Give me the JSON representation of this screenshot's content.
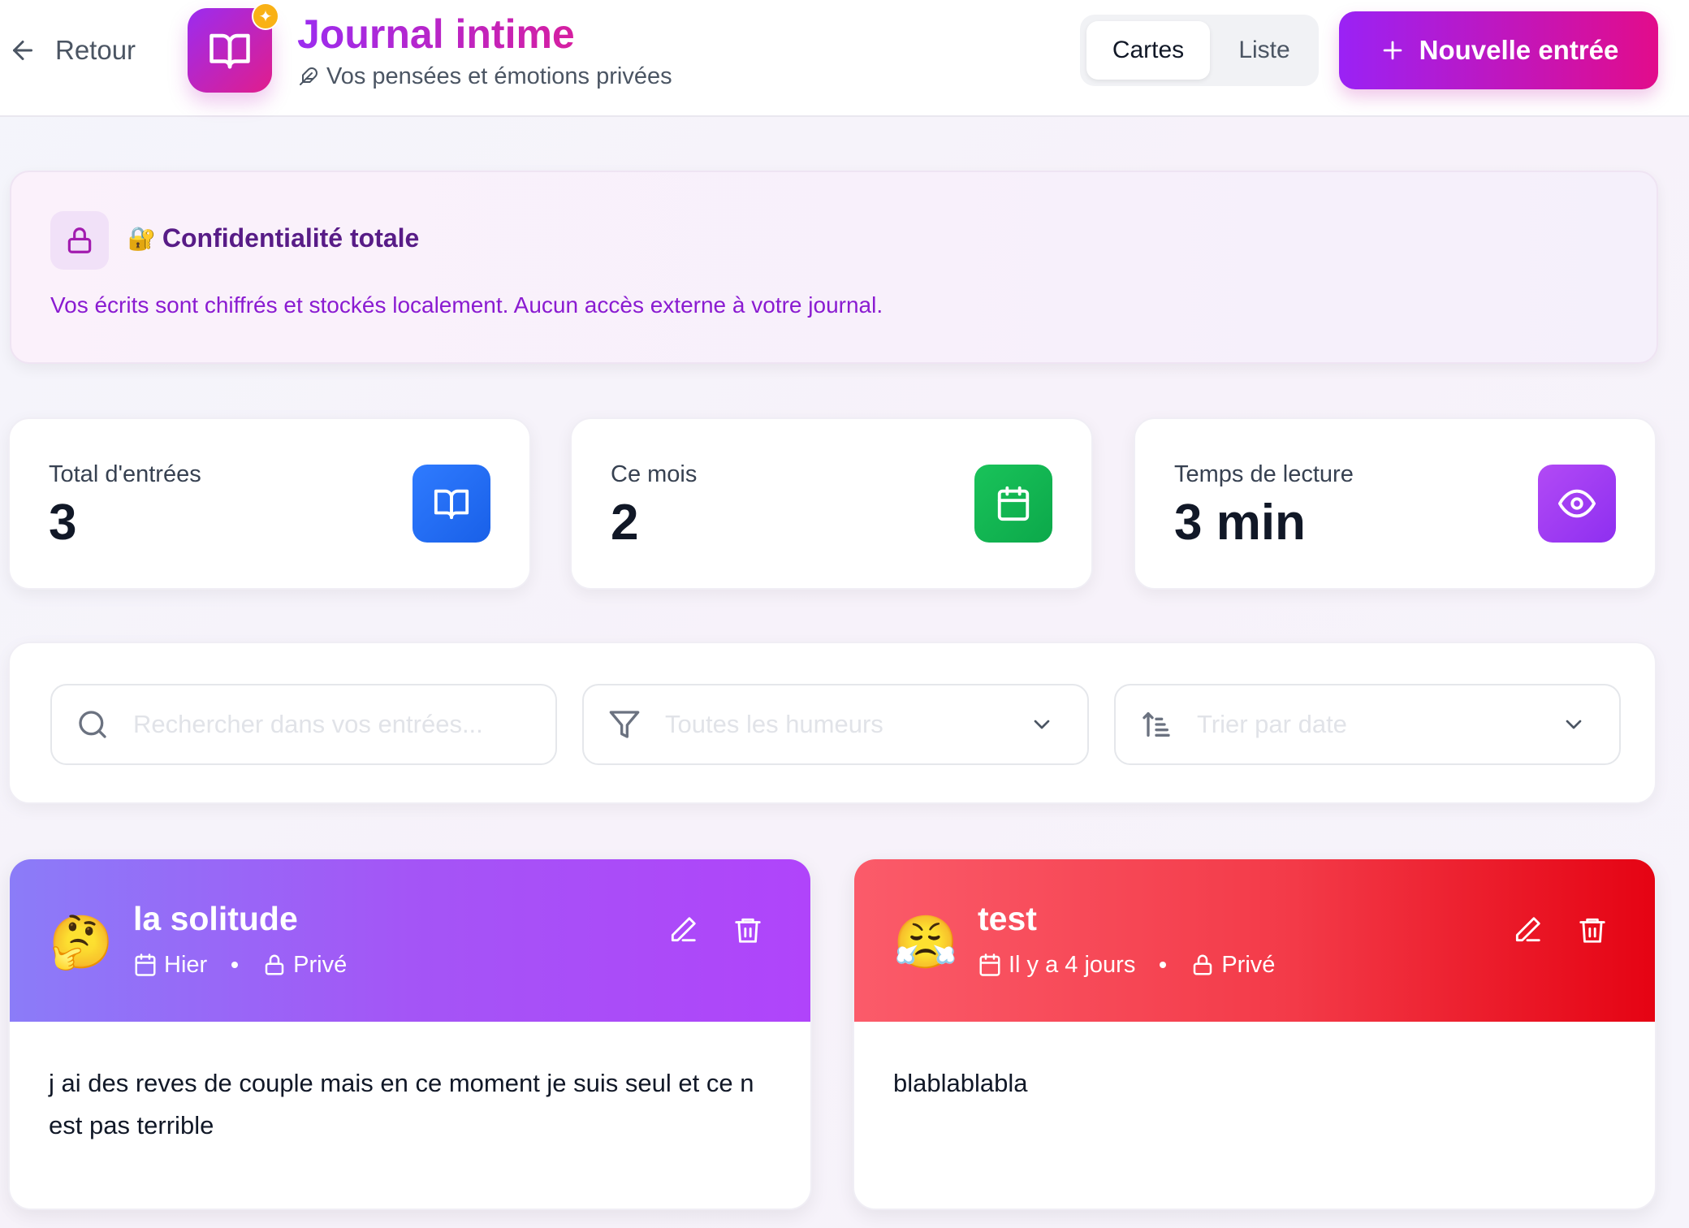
{
  "header": {
    "back_label": "Retour",
    "title": "Journal intime",
    "subtitle": "Vos pensées et émotions privées",
    "view_toggle": {
      "cards": "Cartes",
      "list": "Liste",
      "active": "Cartes"
    },
    "new_entry_label": "Nouvelle entrée"
  },
  "privacy": {
    "title": "Confidentialité totale",
    "text": "Vos écrits sont chiffrés et stockés localement. Aucun accès externe à votre journal."
  },
  "stats": [
    {
      "label": "Total d'entrées",
      "value": "3",
      "icon": "book-open-icon",
      "color": "#1e6cf5"
    },
    {
      "label": "Ce mois",
      "value": "2",
      "icon": "calendar-icon",
      "color": "#10b14f"
    },
    {
      "label": "Temps de lecture",
      "value": "3 min",
      "icon": "eye-icon",
      "color": "#9d3bf3"
    }
  ],
  "filters": {
    "search_placeholder": "Rechercher dans vos entrées...",
    "mood_select": "Toutes les humeurs",
    "sort_select": "Trier par date"
  },
  "entries": [
    {
      "title": "la solitude",
      "mood_emoji": "🤔",
      "date": "Hier",
      "visibility": "Privé",
      "body": "j ai des reves de couple mais en ce moment je suis seul et ce n est pas terrible",
      "header_color": "#a455f6"
    },
    {
      "title": "test",
      "mood_emoji": "😤",
      "date": "Il y a 4 jours",
      "visibility": "Privé",
      "body": "blablablabla",
      "header_color": "#f33a48"
    }
  ],
  "colors": {
    "accent_start": "#9b2cf0",
    "accent_end": "#e20c8b",
    "privacy_title": "#581c87",
    "privacy_text": "#8a1bd1"
  }
}
